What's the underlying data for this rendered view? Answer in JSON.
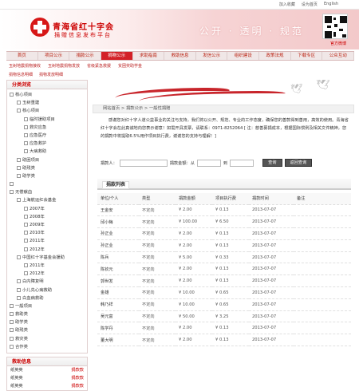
{
  "top_links": [
    "加入收藏",
    "设为首页",
    "English"
  ],
  "header": {
    "title": "青海省红十字会",
    "subtitle": "捐赠信息发布平台",
    "slogan": "公开 · 透明 · 规范",
    "qr_label": "官方微博"
  },
  "nav": [
    {
      "label": "首页",
      "active": false
    },
    {
      "label": "项目公示",
      "active": false
    },
    {
      "label": "捐款公示",
      "active": false
    },
    {
      "label": "捐物公示",
      "active": true
    },
    {
      "label": "求助指南",
      "active": false
    },
    {
      "label": "救助信息",
      "active": false
    },
    {
      "label": "发信公示",
      "active": false
    },
    {
      "label": "组织建设",
      "active": false
    },
    {
      "label": "政策法规",
      "active": false
    },
    {
      "label": "下载专区",
      "active": false
    },
    {
      "label": "公众互动",
      "active": false
    }
  ],
  "sublinks": [
    "玉树地震捐物接收",
    "玉树地震捐物发放",
    "省级紧急救援",
    "贫困奖助学金"
  ],
  "sublinks2": [
    "捐物信息明细",
    "捐物发放明细"
  ],
  "sidebar": {
    "category_title": "分类浏览",
    "tree": [
      {
        "label": "核心项目",
        "level": 0
      },
      {
        "label": "玉树重建",
        "level": 1
      },
      {
        "label": "核心项目",
        "level": 1
      },
      {
        "label": "临时援助项目",
        "level": 2
      },
      {
        "label": "救灾应急",
        "level": 2
      },
      {
        "label": "应急医疗",
        "level": 2
      },
      {
        "label": "应急救护",
        "level": 2
      },
      {
        "label": "大病救助",
        "level": 2
      },
      {
        "label": "助困项目",
        "level": 1
      },
      {
        "label": "助残类",
        "level": 1
      },
      {
        "label": "助学类",
        "level": 1
      },
      {
        "label": "",
        "level": 0
      },
      {
        "label": "无偿献血",
        "level": 0
      },
      {
        "label": "上海航运红会基金",
        "level": 1
      },
      {
        "label": "2007年",
        "level": 2
      },
      {
        "label": "2008年",
        "level": 2
      },
      {
        "label": "2009年",
        "level": 2
      },
      {
        "label": "2010年",
        "level": 2
      },
      {
        "label": "2011年",
        "level": 2
      },
      {
        "label": "2012年",
        "level": 2
      },
      {
        "label": "中国红十字基金会援助",
        "level": 1
      },
      {
        "label": "2011年",
        "level": 2
      },
      {
        "label": "2012年",
        "level": 2
      },
      {
        "label": "白内障复明",
        "level": 1
      },
      {
        "label": "小儿先心病救助",
        "level": 1
      },
      {
        "label": "白血病救助",
        "level": 1
      },
      {
        "label": "一般项目",
        "level": 0
      },
      {
        "label": "救助类",
        "level": 0
      },
      {
        "label": "助学类",
        "level": 0
      },
      {
        "label": "助残类",
        "level": 0
      },
      {
        "label": "救灾类",
        "level": 0
      },
      {
        "label": "合作类",
        "level": 0
      }
    ],
    "donors_title": "救助信息",
    "donors": [
      {
        "name": "纸英英",
        "amount": "捐款款"
      },
      {
        "name": "纸英英",
        "amount": "捐款款"
      },
      {
        "name": "纸英英",
        "amount": "捐款款"
      }
    ]
  },
  "main": {
    "breadcrumb": "网站首页 > 捐款公示 > 一般性捐赠",
    "intro": "感谢您对红十字人道公益事业的关注与支持，我们将以公开、规范、专业的工作态度，确保您的善款得到善用，高效的使用。青海省红十字会在此真诚地向您表示谢意！如需开具发票，请联系：0971-8252064 [ 注：慈善募捐成本，根据国际惯例及相关文件精神，您的捐款中将提取6.5%用作项目执行费，谢谢您的支持与理解！]",
    "filter": {
      "donor_label": "捐款人：",
      "amount_label": "捐款金额：从",
      "to_label": "到",
      "query_btn": "查询",
      "reset_btn": "返回查询"
    },
    "list_title": "捐款列表",
    "columns": [
      "单位/个人",
      "类型",
      "捐款金额",
      "项目执行费",
      "捐款时间",
      "备注"
    ],
    "rows": [
      [
        "王金安",
        "不定向",
        "¥ 2.00",
        "¥ 0.13",
        "2013-07-07",
        ""
      ],
      [
        "邱小梅",
        "不定向",
        "¥ 100.00",
        "¥ 6.50",
        "2013-07-07",
        ""
      ],
      [
        "孙正业",
        "不定向",
        "¥ 2.00",
        "¥ 0.13",
        "2013-07-07",
        ""
      ],
      [
        "孙正业",
        "不定向",
        "¥ 2.00",
        "¥ 0.13",
        "2013-07-07",
        ""
      ],
      [
        "陈兵",
        "不定向",
        "¥ 5.00",
        "¥ 0.33",
        "2013-07-07",
        ""
      ],
      [
        "陈钦元",
        "不定向",
        "¥ 2.00",
        "¥ 0.13",
        "2013-07-07",
        ""
      ],
      [
        "郭世发",
        "不定向",
        "¥ 2.00",
        "¥ 0.13",
        "2013-07-07",
        ""
      ],
      [
        "金雄",
        "不定向",
        "¥ 10.00",
        "¥ 0.65",
        "2013-07-07",
        ""
      ],
      [
        "韩乃祥",
        "不定向",
        "¥ 10.00",
        "¥ 0.65",
        "2013-07-07",
        ""
      ],
      [
        "吴元富",
        "不定向",
        "¥ 50.00",
        "¥ 3.25",
        "2013-07-07",
        ""
      ],
      [
        "陈学丹",
        "不定向",
        "¥ 2.00",
        "¥ 0.13",
        "2013-07-07",
        ""
      ],
      [
        "董大明",
        "不定向",
        "¥ 2.00",
        "¥ 0.13",
        "2013-07-07",
        ""
      ]
    ]
  }
}
